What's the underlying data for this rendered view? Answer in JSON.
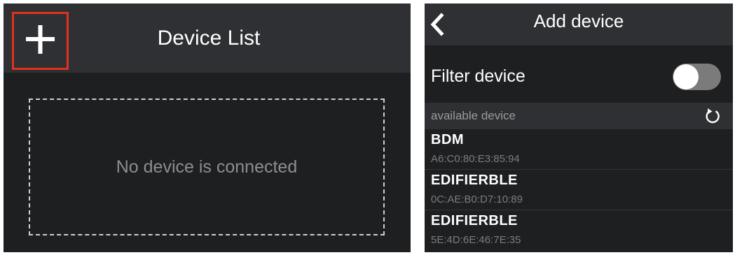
{
  "device_list": {
    "title": "Device List",
    "add_icon": "plus-icon",
    "empty_message": "No device is connected",
    "highlight_color": "#e0321c"
  },
  "add_device": {
    "title": "Add device",
    "back_icon": "chevron-left-icon",
    "filter": {
      "label": "Filter device",
      "enabled": false
    },
    "section_label": "available device",
    "refresh_icon": "refresh-icon",
    "devices": [
      {
        "name": "BDM",
        "mac": "A6:C0:80:E3:85:94"
      },
      {
        "name": "EDIFIERBLE",
        "mac": "0C:AE:B0:D7:10:89"
      },
      {
        "name": "EDIFIERBLE",
        "mac": "5E:4D:6E:46:7E:35"
      }
    ]
  }
}
